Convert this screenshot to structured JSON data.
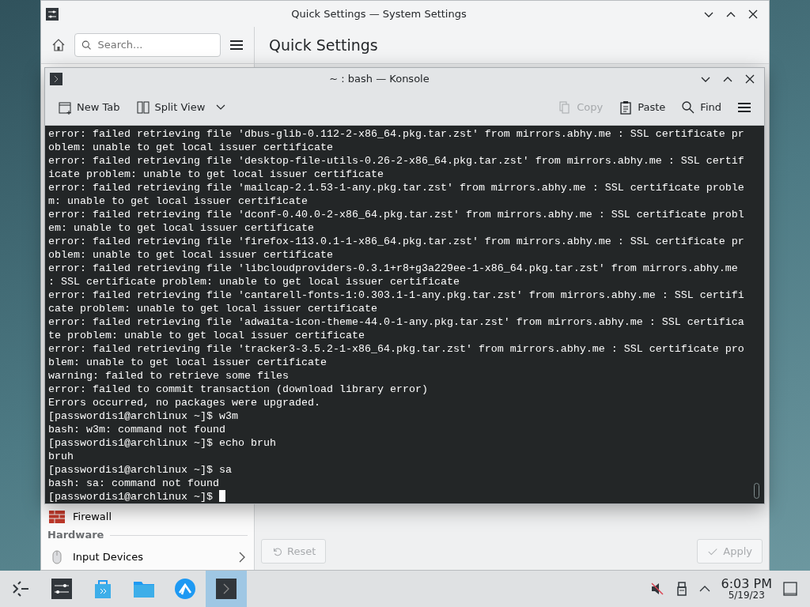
{
  "settings_window": {
    "title": "Quick Settings — System Settings",
    "search": {
      "placeholder": "Search..."
    },
    "page_title": "Quick Settings",
    "sidebar": {
      "items": [
        {
          "label": "Firewall"
        }
      ],
      "sections": [
        {
          "header": "Hardware",
          "items": [
            {
              "label": "Input Devices"
            }
          ]
        }
      ]
    },
    "buttons": [
      {
        "kind": "reset",
        "label": "Reset",
        "disabled": true
      },
      {
        "kind": "apply",
        "label": "Apply",
        "disabled": true
      }
    ]
  },
  "konsole": {
    "title": "~ : bash — Konsole",
    "toolbar": [
      {
        "kind": "new-tab",
        "label": "New Tab",
        "disabled": false
      },
      {
        "kind": "split-view",
        "label": "Split View",
        "disabled": false
      },
      {
        "kind": "copy",
        "label": "Copy",
        "disabled": true
      },
      {
        "kind": "paste",
        "label": "Paste",
        "disabled": false
      },
      {
        "kind": "find",
        "label": "Find",
        "disabled": false
      }
    ],
    "lines": [
      "error: failed retrieving file 'dbus-glib-0.112-2-x86_64.pkg.tar.zst' from mirrors.abhy.me : SSL certificate pr",
      "oblem: unable to get local issuer certificate",
      "error: failed retrieving file 'desktop-file-utils-0.26-2-x86_64.pkg.tar.zst' from mirrors.abhy.me : SSL certif",
      "icate problem: unable to get local issuer certificate",
      "error: failed retrieving file 'mailcap-2.1.53-1-any.pkg.tar.zst' from mirrors.abhy.me : SSL certificate proble",
      "m: unable to get local issuer certificate",
      "error: failed retrieving file 'dconf-0.40.0-2-x86_64.pkg.tar.zst' from mirrors.abhy.me : SSL certificate probl",
      "em: unable to get local issuer certificate",
      "error: failed retrieving file 'firefox-113.0.1-1-x86_64.pkg.tar.zst' from mirrors.abhy.me : SSL certificate pr",
      "oblem: unable to get local issuer certificate",
      "error: failed retrieving file 'libcloudproviders-0.3.1+r8+g3a229ee-1-x86_64.pkg.tar.zst' from mirrors.abhy.me",
      ": SSL certificate problem: unable to get local issuer certificate",
      "error: failed retrieving file 'cantarell-fonts-1:0.303.1-1-any.pkg.tar.zst' from mirrors.abhy.me : SSL certifi",
      "cate problem: unable to get local issuer certificate",
      "error: failed retrieving file 'adwaita-icon-theme-44.0-1-any.pkg.tar.zst' from mirrors.abhy.me : SSL certifica",
      "te problem: unable to get local issuer certificate",
      "error: failed retrieving file 'tracker3-3.5.2-1-x86_64.pkg.tar.zst' from mirrors.abhy.me : SSL certificate pro",
      "blem: unable to get local issuer certificate",
      "warning: failed to retrieve some files",
      "error: failed to commit transaction (download library error)",
      "Errors occurred, no packages were upgraded.",
      "[passwordis1@archlinux ~]$ w3m",
      "bash: w3m: command not found",
      "[passwordis1@archlinux ~]$ echo bruh",
      "bruh",
      "[passwordis1@archlinux ~]$ sa",
      "bash: sa: command not found",
      "[passwordis1@archlinux ~]$"
    ]
  },
  "taskbar": {
    "tasks": [
      {
        "kind": "settings",
        "selected": false
      },
      {
        "kind": "store",
        "selected": false
      },
      {
        "kind": "files",
        "selected": false
      },
      {
        "kind": "browser",
        "selected": false
      },
      {
        "kind": "terminal",
        "selected": true
      }
    ],
    "clock": {
      "time": "6:03 PM",
      "date": "5/19/23"
    }
  }
}
